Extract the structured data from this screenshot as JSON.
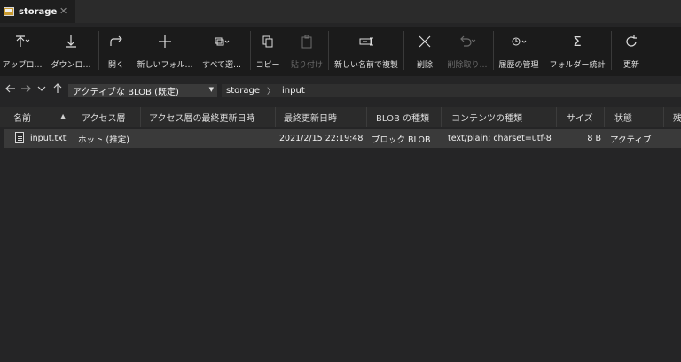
{
  "tab": {
    "title": "storage",
    "close": "✕"
  },
  "toolbar": {
    "upload": "アップロ…",
    "download": "ダウンロ…",
    "open": "開く",
    "new_folder": "新しいフォル…",
    "select_all": "すべて選…",
    "copy": "コピー",
    "paste": "貼り付け",
    "clone": "新しい名前で複製",
    "delete": "削除",
    "undelete": "削除取り…",
    "history": "履歴の管理",
    "folder_stats": "フォルダー統計",
    "refresh": "更新"
  },
  "nav": {
    "access_tier": "アクティブな BLOB (既定)",
    "breadcrumb": [
      "storage",
      "input"
    ],
    "crumb_sep": "〉"
  },
  "table": {
    "columns": [
      "名前",
      "アクセス層",
      "アクセス層の最終更新日時",
      "最終更新日時",
      "BLOB の種類",
      "コンテンツの種類",
      "サイズ",
      "状態",
      "残"
    ],
    "rows": [
      {
        "name": "input.txt",
        "access_tier": "ホット (推定)",
        "tier_modified": "",
        "modified": "2021/2/15 22:19:48",
        "blob_type": "ブロック BLOB",
        "content_type": "text/plain; charset=utf-8",
        "size": "8 B",
        "status": "アクティブ"
      }
    ]
  },
  "icons": {
    "upload": "upload-icon",
    "download": "download-icon",
    "open": "open-icon",
    "new_folder": "plus-icon",
    "select_all": "select-all-icon",
    "copy": "copy-icon",
    "paste": "paste-icon",
    "clone": "clone-icon",
    "delete": "delete-icon",
    "undelete": "undo-icon",
    "history": "history-icon",
    "folder_stats": "sigma-icon",
    "refresh": "refresh-icon"
  },
  "colors": {
    "background": "#252526",
    "toolbar": "#1b1b1b",
    "selected_row": "#3a3a3a",
    "text": "#e8e8e8"
  }
}
